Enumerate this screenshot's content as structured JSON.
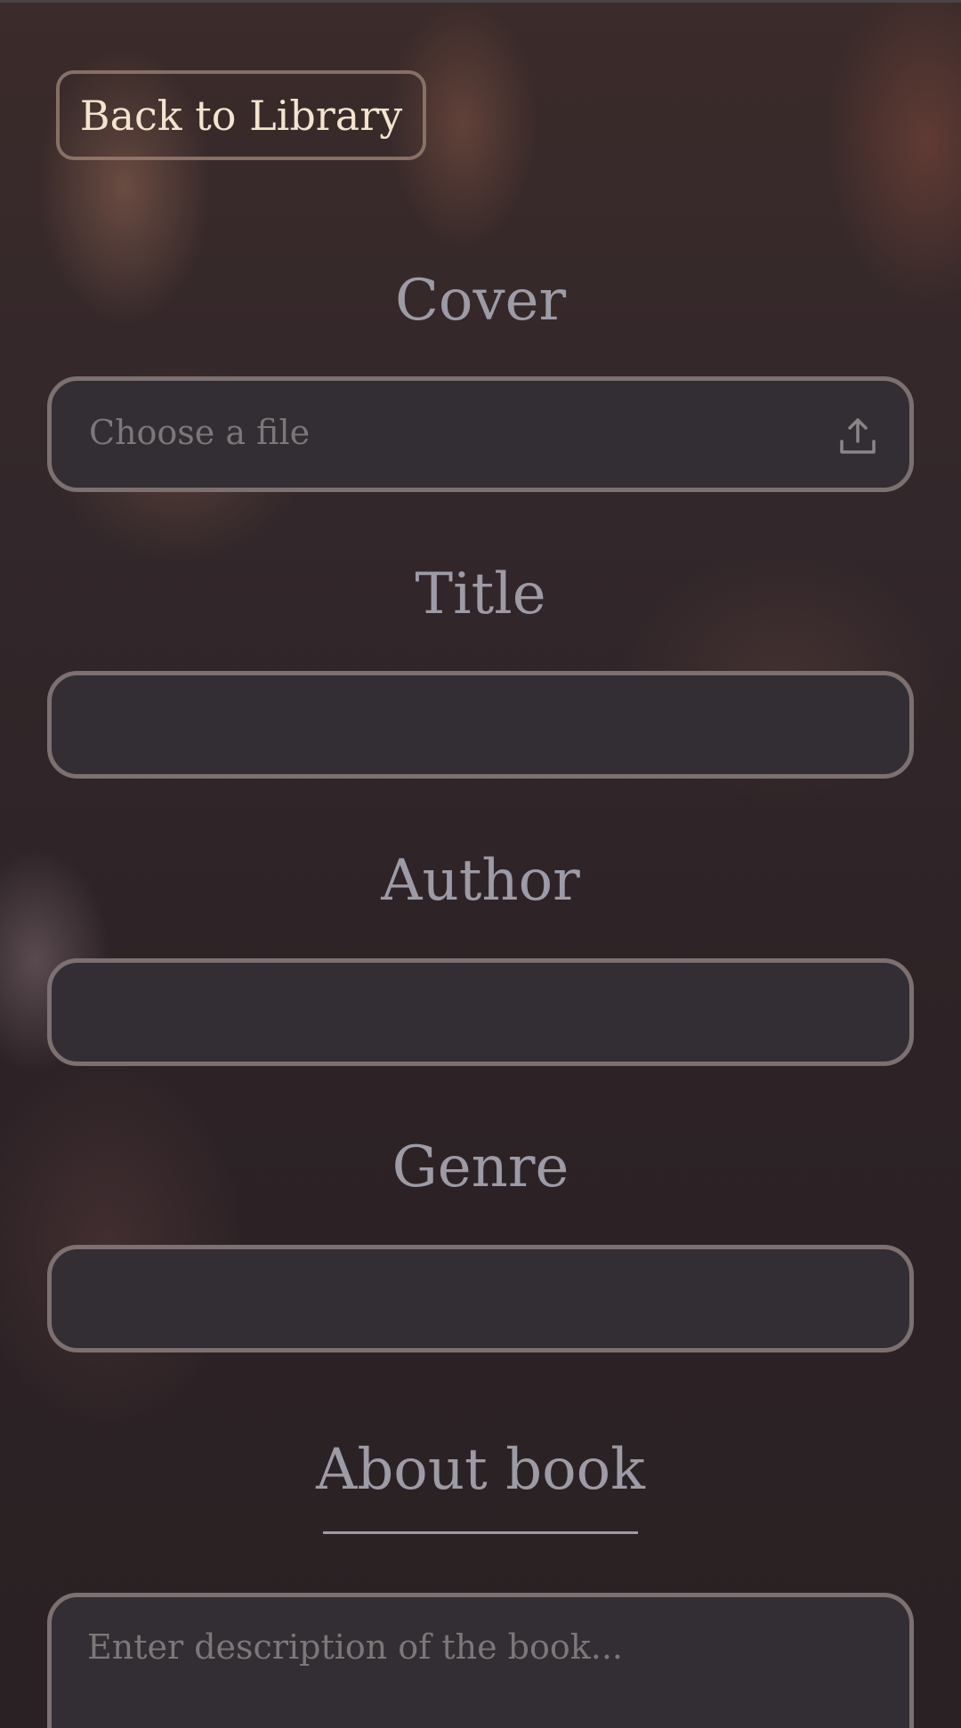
{
  "back_button": {
    "label": "Back to Library"
  },
  "cover": {
    "label": "Cover",
    "placeholder": "Choose a file",
    "icon": "upload-icon"
  },
  "title": {
    "label": "Title",
    "value": ""
  },
  "author": {
    "label": "Author",
    "value": ""
  },
  "genre": {
    "label": "Genre",
    "value": ""
  },
  "about": {
    "label": "About book",
    "placeholder": "Enter description of the book..."
  },
  "colors": {
    "label_text": "#9c9ba6",
    "field_background": "#332e33",
    "field_border": "#7c7170",
    "button_text": "#f2e4cf"
  }
}
